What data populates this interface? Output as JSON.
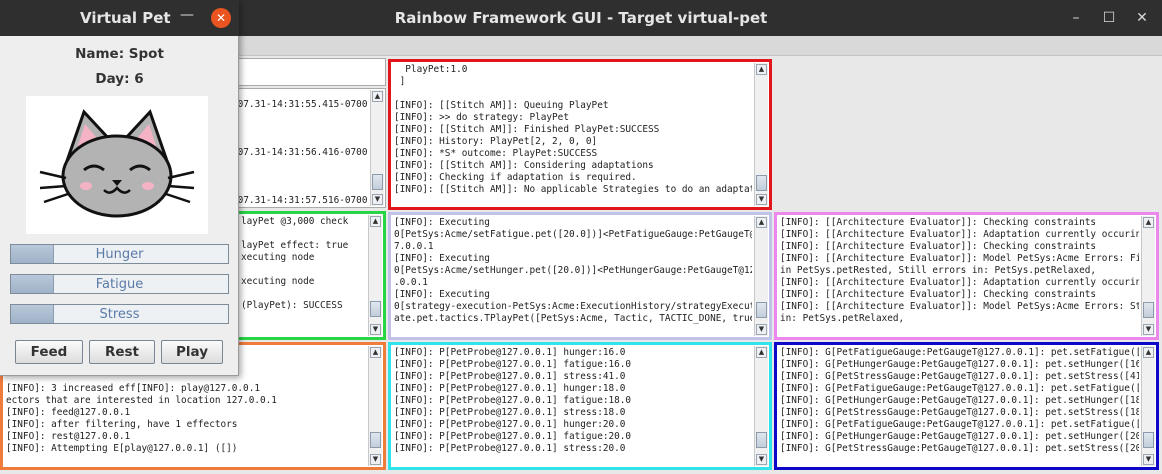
{
  "window": {
    "title": "Rainbow Framework GUI - Target virtual-pet",
    "controls": [
      "–",
      "☐",
      "✕"
    ]
  },
  "panels": {
    "top_left": "",
    "log_timestamps": ".07.31-14:31:55.415-0700\n\n\n\n.07.31-14:31:56.416-0700\n\n\n\n.07.31-14:31:57.516-0700",
    "red": "  PlayPet:1.0\n ]\n\n[INFO]: [[Stitch AM]]: Queuing PlayPet\n[INFO]: >> do strategy: PlayPet\n[INFO]: [[Stitch AM]]: Finished PlayPet:SUCCESS\n[INFO]: History: PlayPet[2, 2, 0, 0]\n[INFO]: *S* outcome: PlayPet:SUCCESS\n[INFO]: [[Stitch AM]]: Considering adaptations\n[INFO]: Checking if adaptation is required.\n[INFO]: [[Stitch AM]]: No applicable Strategies to do an adaptation!",
    "green": "layPet @3,000 check\n\nlayPet effect: true\nxecuting node\n\nxecuting node\n\n(PlayPet): SUCCESS",
    "lavender": "[INFO]: Executing\n0[PetSys:Acme/setFatigue.pet([20.0])]<PetFatigueGauge:PetGaugeT@12\n7.0.0.1\n[INFO]: Executing\n0[PetSys:Acme/setHunger.pet([20.0])]<PetHungerGauge:PetGaugeT@127\n.0.0.1\n[INFO]: Executing\n0[strategy-execution-PetSys:Acme:ExecutionHistory/strategyExecutionSt\nate.pet.tactics.TPlayPet([PetSys:Acme, Tactic, TACTIC_DONE, true])]",
    "pink": "[INFO]: [[Architecture Evaluator]]: Checking constraints\n[INFO]: [[Architecture Evaluator]]: Adaptation currently occuring\n[INFO]: [[Architecture Evaluator]]: Checking constraints\n[INFO]: [[Architecture Evaluator]]: Model PetSys:Acme Errors: Fixed errors\nin PetSys.petRested, Still errors in: PetSys.petRelaxed,\n[INFO]: [[Architecture Evaluator]]: Adaptation currently occuring\n[INFO]: [[Architecture Evaluator]]: Checking constraints\n[INFO]: [[Architecture Evaluator]]: Model PetSys:Acme Errors: Still errors\nin: PetSys.petRelaxed,",
    "orange": "\n\n\n[INFO]: 3 increased eff[INFO]: play@127.0.0.1\nectors that are interested in location 127.0.0.1\n[INFO]: feed@127.0.0.1\n[INFO]: after filtering, have 1 effectors\n[INFO]: rest@127.0.0.1\n[INFO]: Attempting E[play@127.0.0.1] ([])",
    "cyan": "[INFO]: P[PetProbe@127.0.0.1] hunger:16.0\n[INFO]: P[PetProbe@127.0.0.1] fatigue:16.0\n[INFO]: P[PetProbe@127.0.0.1] stress:41.0\n[INFO]: P[PetProbe@127.0.0.1] hunger:18.0\n[INFO]: P[PetProbe@127.0.0.1] fatigue:18.0\n[INFO]: P[PetProbe@127.0.0.1] stress:18.0\n[INFO]: P[PetProbe@127.0.0.1] hunger:20.0\n[INFO]: P[PetProbe@127.0.0.1] fatigue:20.0\n[INFO]: P[PetProbe@127.0.0.1] stress:20.0",
    "blue": "[INFO]: G[PetFatigueGauge:PetGaugeT@127.0.0.1]: pet.setFatigue([16.0])\n[INFO]: G[PetHungerGauge:PetGaugeT@127.0.0.1]: pet.setHunger([16.0])\n[INFO]: G[PetStressGauge:PetGaugeT@127.0.0.1]: pet.setStress([41.0])\n[INFO]: G[PetFatigueGauge:PetGaugeT@127.0.0.1]: pet.setFatigue([18.0])\n[INFO]: G[PetHungerGauge:PetGaugeT@127.0.0.1]: pet.setHunger([18.0])\n[INFO]: G[PetStressGauge:PetGaugeT@127.0.0.1]: pet.setStress([18.0])\n[INFO]: G[PetFatigueGauge:PetGaugeT@127.0.0.1]: pet.setFatigue([20.0])\n[INFO]: G[PetHungerGauge:PetGaugeT@127.0.0.1]: pet.setHunger([20.0])\n[INFO]: G[PetStressGauge:PetGaugeT@127.0.0.1]: pet.setStress([20.0])"
  },
  "panel_colors": {
    "red": "#e0161b",
    "green": "#28d645",
    "lavender": "#c2c2e8",
    "pink": "#ec88ec",
    "orange": "#f07c3c",
    "cyan": "#30e4ea",
    "blue": "#0d08c8"
  },
  "pet": {
    "title": "Virtual Pet",
    "name": "Name: Spot",
    "day": "Day: 6",
    "image": "cat-face",
    "bars": [
      {
        "label": "Hunger",
        "level": 0.2
      },
      {
        "label": "Fatigue",
        "level": 0.2
      },
      {
        "label": "Stress",
        "level": 0.2
      }
    ],
    "buttons": [
      "Feed",
      "Rest",
      "Play"
    ]
  }
}
